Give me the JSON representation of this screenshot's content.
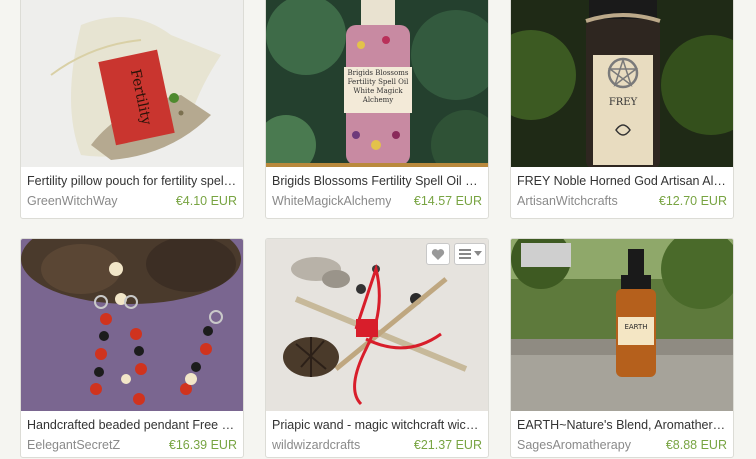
{
  "listings": [
    {
      "title": "Fertility pillow pouch for fertility spells...",
      "shop": "GreenWitchWay",
      "price": "€4.10 EUR",
      "image_text": "Fertility"
    },
    {
      "title": "Brigids Blossoms Fertility Spell Oil 1....",
      "shop": "WhiteMagickAlchemy",
      "price": "€14.57 EUR",
      "image_text": "Brigids Blossoms Fertility Spell Oil White Magick Alchemy"
    },
    {
      "title": "FREY Noble Horned God Artisan Alc...",
      "shop": "ArtisanWitchcrafts",
      "price": "€12.70 EUR",
      "image_text": "FREY"
    },
    {
      "title": "Handcrafted beaded pendant Free F...",
      "shop": "EelegantSecretZ",
      "price": "€16.39 EUR"
    },
    {
      "title": "Priapic wand - magic witchcraft wicca...",
      "shop": "wildwizardcrafts",
      "price": "€21.37 EUR"
    },
    {
      "title": "EARTH~Nature's Blend, Aromathera...",
      "shop": "SagesAromatherapy",
      "price": "€8.88 EUR",
      "image_text": "EARTH"
    }
  ],
  "hover_actions": {
    "favorite_icon": "heart-icon",
    "menu_icon": "list-icon",
    "menu_caret": "caret-down-icon"
  },
  "colors": {
    "price": "#78a442",
    "shop": "#8a8a8a",
    "background": "#f5f5f1"
  }
}
